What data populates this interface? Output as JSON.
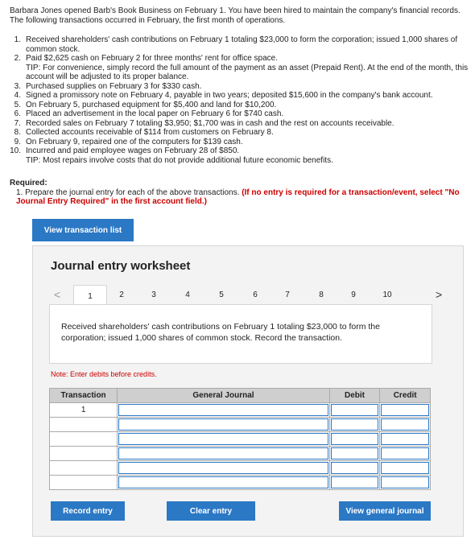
{
  "intro": "Barbara Jones opened Barb's Book Business on February 1. You have been hired to maintain the company's financial records. The following transactions occurred in February, the first month of operations.",
  "transactions": [
    {
      "num": "1.",
      "text": "Received shareholders' cash contributions on February 1 totaling $23,000 to form the corporation; issued 1,000 shares of common stock.",
      "tip": ""
    },
    {
      "num": "2.",
      "text": "Paid $2,625 cash on February 2 for three months' rent for office space.",
      "tip": "TIP: For convenience, simply record the full amount of the payment as an asset (Prepaid Rent). At the end of the month, this account will be adjusted to its proper balance."
    },
    {
      "num": "3.",
      "text": "Purchased supplies on February 3 for $330 cash.",
      "tip": ""
    },
    {
      "num": "4.",
      "text": "Signed a promissory note on February 4, payable in two years; deposited $15,600 in the company's bank account.",
      "tip": ""
    },
    {
      "num": "5.",
      "text": "On February 5, purchased equipment for $5,400 and land for $10,200.",
      "tip": ""
    },
    {
      "num": "6.",
      "text": "Placed an advertisement in the local paper on February 6 for $740 cash.",
      "tip": ""
    },
    {
      "num": "7.",
      "text": "Recorded sales on February 7 totaling $3,950; $1,700 was in cash and the rest on accounts receivable.",
      "tip": ""
    },
    {
      "num": "8.",
      "text": "Collected accounts receivable of $114 from customers on February 8.",
      "tip": ""
    },
    {
      "num": "9.",
      "text": "On February 9, repaired one of the computers for $139 cash.",
      "tip": ""
    },
    {
      "num": "10.",
      "text": "Incurred and paid employee wages on February 28 of $850.",
      "tip": "TIP: Most repairs involve costs that do not provide additional future economic benefits."
    }
  ],
  "required": {
    "title": "Required:",
    "item_num": "1.",
    "item_text": "Prepare the journal entry for each of the above transactions.",
    "item_red": "(If no entry is required for a transaction/event, select \"No Journal Entry Required\" in the first account field.)"
  },
  "buttons": {
    "view_list": "View transaction list",
    "record": "Record entry",
    "clear": "Clear entry",
    "view_journal": "View general journal"
  },
  "worksheet": {
    "title": "Journal entry worksheet",
    "tabs": [
      "1",
      "2",
      "3",
      "4",
      "5",
      "6",
      "7",
      "8",
      "9",
      "10"
    ],
    "active_tab": 0,
    "prev_arrow": "<",
    "next_arrow": ">",
    "description": "Received shareholders' cash contributions on February 1 totaling $23,000 to form the corporation; issued 1,000 shares of common stock. Record the transaction.",
    "note": "Note: Enter debits before credits.",
    "columns": [
      "Transaction",
      "General Journal",
      "Debit",
      "Credit"
    ],
    "rows": [
      "1",
      "",
      "",
      "",
      "",
      ""
    ]
  },
  "colors": {
    "accent": "#2b78c5",
    "note_red": "#cc0000"
  }
}
